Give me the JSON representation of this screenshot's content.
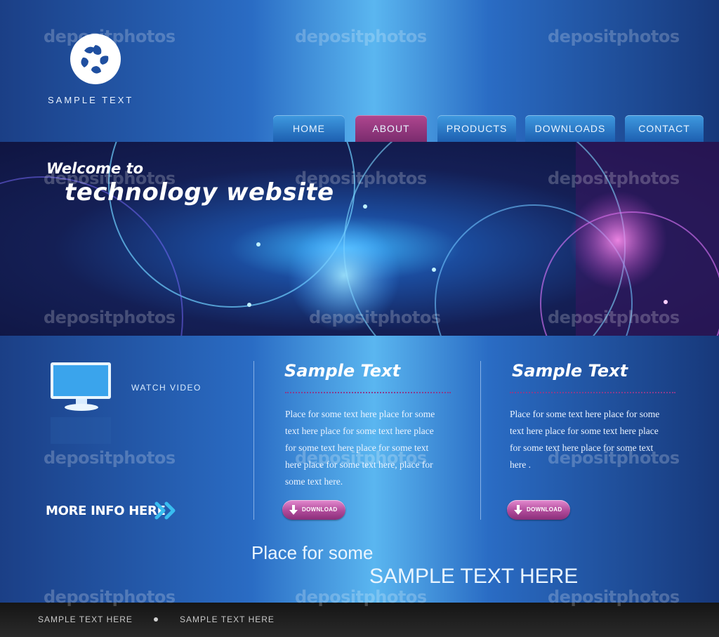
{
  "header": {
    "logo_text": "SAMPLE TEXT",
    "nav": [
      {
        "label": "HOME",
        "active": false
      },
      {
        "label": "ABOUT",
        "active": true
      },
      {
        "label": "PRODUCTS",
        "active": false
      },
      {
        "label": "DOWNLOADS",
        "active": false
      },
      {
        "label": "CONTACT",
        "active": false
      }
    ]
  },
  "banner": {
    "welcome": "Welcome to",
    "title": "technology website"
  },
  "sidebar": {
    "watch_video": "WATCH VIDEO",
    "more_info": "MORE INFO HERE"
  },
  "columns": [
    {
      "title": "Sample Text",
      "body": "Place for some text here place for some text here place for some text here place for some text here place for some text here place for some text here, place for some text here.",
      "button": "DOWNLOAD"
    },
    {
      "title": "Sample Text",
      "body": "Place for some text here place for some text here place for some text here place for some text here place for some text here .",
      "button": "DOWNLOAD"
    }
  ],
  "tagline": {
    "line1": "Place for some",
    "line2": "SAMPLE TEXT HERE"
  },
  "footer": {
    "links": [
      "SAMPLE TEXT HERE",
      "SAMPLE TEXT HERE"
    ]
  },
  "watermark": "depositphotos",
  "colors": {
    "nav_tab": "#2a78cc",
    "nav_active": "#9b3a85",
    "download_button": "#b04a9a",
    "footer_bg": "#1e1e1e"
  }
}
